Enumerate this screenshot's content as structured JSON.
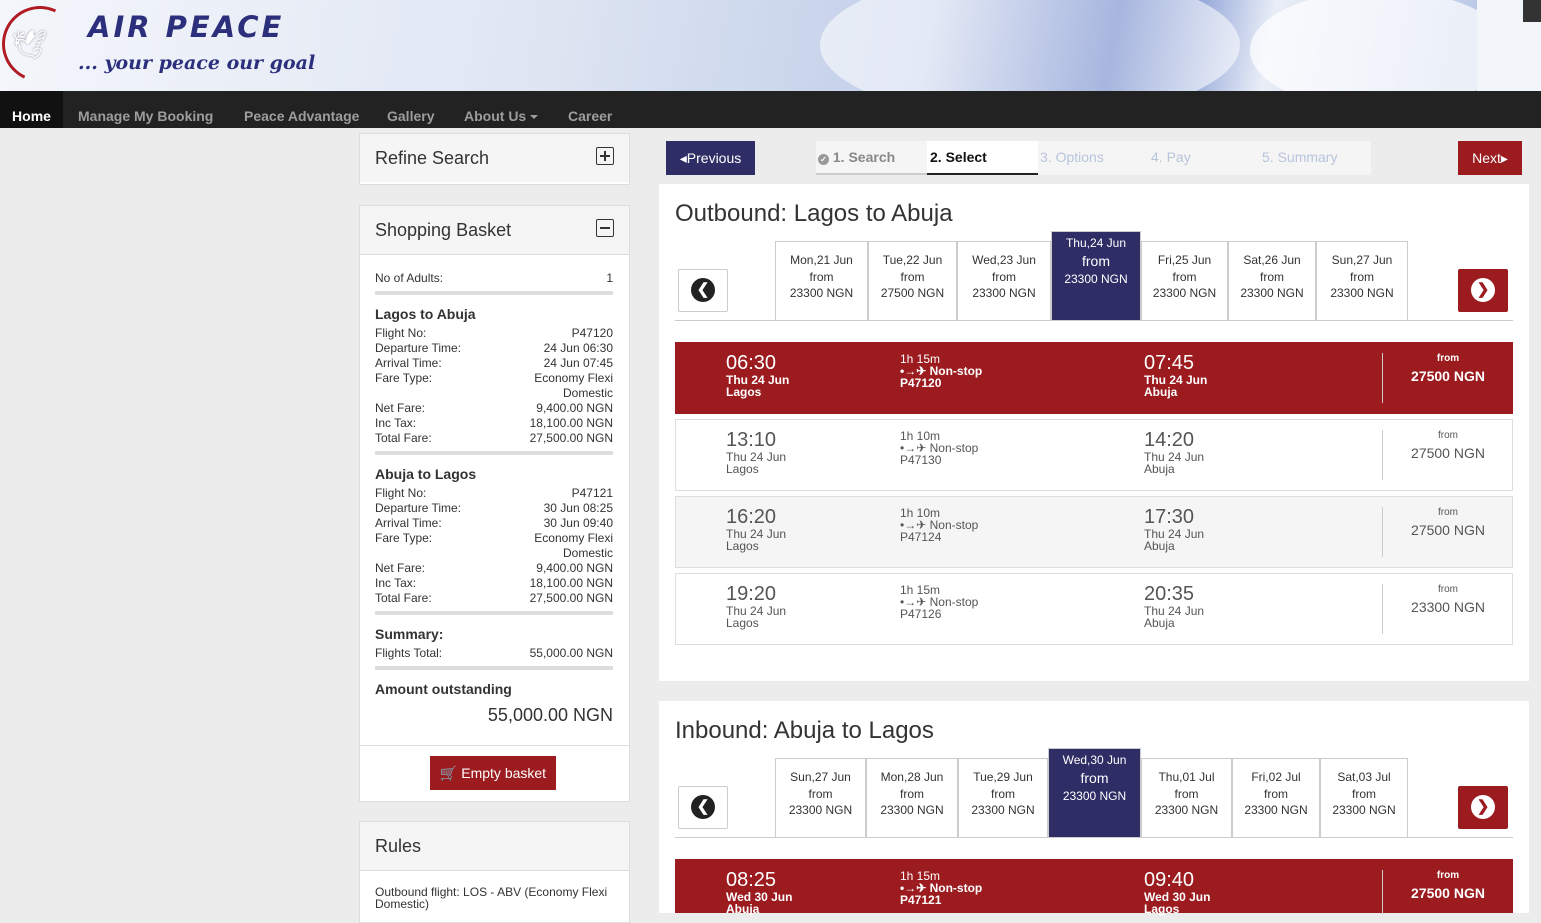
{
  "brand": {
    "name": "AIR PEACE",
    "tagline": "... your peace our goal"
  },
  "nav": [
    "Home",
    "Manage My Booking",
    "Peace Advantage",
    "Gallery",
    "About Us",
    "Career"
  ],
  "refine": {
    "title": "Refine Search"
  },
  "basket": {
    "title": "Shopping Basket",
    "adults_label": "No of Adults:",
    "adults": "1",
    "legs": [
      {
        "route": "Lagos to Abuja",
        "rows": [
          [
            "Flight No:",
            "P47120"
          ],
          [
            "Departure Time:",
            "24 Jun 06:30"
          ],
          [
            "Arrival Time:",
            "24 Jun 07:45"
          ],
          [
            "Fare Type:",
            "Economy Flexi"
          ],
          [
            "",
            "Domestic"
          ],
          [
            "Net Fare:",
            "9,400.00 NGN"
          ],
          [
            "Inc Tax:",
            "18,100.00 NGN"
          ],
          [
            "Total Fare:",
            "27,500.00 NGN"
          ]
        ]
      },
      {
        "route": "Abuja to Lagos",
        "rows": [
          [
            "Flight No:",
            "P47121"
          ],
          [
            "Departure Time:",
            "30 Jun 08:25"
          ],
          [
            "Arrival Time:",
            "30 Jun 09:40"
          ],
          [
            "Fare Type:",
            "Economy Flexi"
          ],
          [
            "",
            "Domestic"
          ],
          [
            "Net Fare:",
            "9,400.00 NGN"
          ],
          [
            "Inc Tax:",
            "18,100.00 NGN"
          ],
          [
            "Total Fare:",
            "27,500.00 NGN"
          ]
        ]
      }
    ],
    "summary_label": "Summary:",
    "flights_total_label": "Flights Total:",
    "flights_total": "55,000.00 NGN",
    "outstanding_label": "Amount outstanding",
    "outstanding": "55,000.00 NGN",
    "empty_label": "Empty basket"
  },
  "rules": {
    "title": "Rules",
    "text": "Outbound flight: LOS - ABV (Economy Flexi Domestic)"
  },
  "wizard": {
    "prev": "Previous",
    "next": "Next",
    "steps": [
      "1. Search",
      "2. Select",
      "3. Options",
      "4. Pay",
      "5. Summary"
    ]
  },
  "outbound": {
    "title": "Outbound: Lagos to Abuja",
    "dates": [
      {
        "day": "Mon,21 Jun",
        "from": "from",
        "price": "23300 NGN"
      },
      {
        "day": "Tue,22 Jun",
        "from": "from",
        "price": "27500 NGN"
      },
      {
        "day": "Wed,23 Jun",
        "from": "from",
        "price": "23300 NGN"
      },
      {
        "day": "Thu,24 Jun",
        "from": "from",
        "price": "23300 NGN"
      },
      {
        "day": "Fri,25 Jun",
        "from": "from",
        "price": "23300 NGN"
      },
      {
        "day": "Sat,26 Jun",
        "from": "from",
        "price": "23300 NGN"
      },
      {
        "day": "Sun,27 Jun",
        "from": "from",
        "price": "23300 NGN"
      }
    ],
    "flights": [
      {
        "dep": "06:30",
        "dep_date": "Thu 24 Jun",
        "dep_city": "Lagos",
        "dur": "1h 15m",
        "stop": "Non-stop",
        "no": "P47120",
        "arr": "07:45",
        "arr_date": "Thu 24 Jun",
        "arr_city": "Abuja",
        "from": "from",
        "price": "27500 NGN"
      },
      {
        "dep": "13:10",
        "dep_date": "Thu 24 Jun",
        "dep_city": "Lagos",
        "dur": "1h 10m",
        "stop": "Non-stop",
        "no": "P47130",
        "arr": "14:20",
        "arr_date": "Thu 24 Jun",
        "arr_city": "Abuja",
        "from": "from",
        "price": "27500 NGN"
      },
      {
        "dep": "16:20",
        "dep_date": "Thu 24 Jun",
        "dep_city": "Lagos",
        "dur": "1h 10m",
        "stop": "Non-stop",
        "no": "P47124",
        "arr": "17:30",
        "arr_date": "Thu 24 Jun",
        "arr_city": "Abuja",
        "from": "from",
        "price": "27500 NGN"
      },
      {
        "dep": "19:20",
        "dep_date": "Thu 24 Jun",
        "dep_city": "Lagos",
        "dur": "1h 15m",
        "stop": "Non-stop",
        "no": "P47126",
        "arr": "20:35",
        "arr_date": "Thu 24 Jun",
        "arr_city": "Abuja",
        "from": "from",
        "price": "23300 NGN"
      }
    ]
  },
  "inbound": {
    "title": "Inbound: Abuja to Lagos",
    "dates": [
      {
        "day": "Sun,27 Jun",
        "from": "from",
        "price": "23300 NGN"
      },
      {
        "day": "Mon,28 Jun",
        "from": "from",
        "price": "23300 NGN"
      },
      {
        "day": "Tue,29 Jun",
        "from": "from",
        "price": "23300 NGN"
      },
      {
        "day": "Wed,30 Jun",
        "from": "from",
        "price": "23300 NGN"
      },
      {
        "day": "Thu,01 Jul",
        "from": "from",
        "price": "23300 NGN"
      },
      {
        "day": "Fri,02 Jul",
        "from": "from",
        "price": "23300 NGN"
      },
      {
        "day": "Sat,03 Jul",
        "from": "from",
        "price": "23300 NGN"
      }
    ],
    "flights": [
      {
        "dep": "08:25",
        "dep_date": "Wed 30 Jun",
        "dep_city": "Abuja",
        "dur": "1h 15m",
        "stop": "Non-stop",
        "no": "P47121",
        "arr": "09:40",
        "arr_date": "Wed 30 Jun",
        "arr_city": "Lagos",
        "from": "from",
        "price": "27500 NGN"
      }
    ]
  },
  "colors": {
    "brand_red": "#9b1b1f",
    "brand_navy": "#2f2d66",
    "nav_bg": "#222222"
  }
}
